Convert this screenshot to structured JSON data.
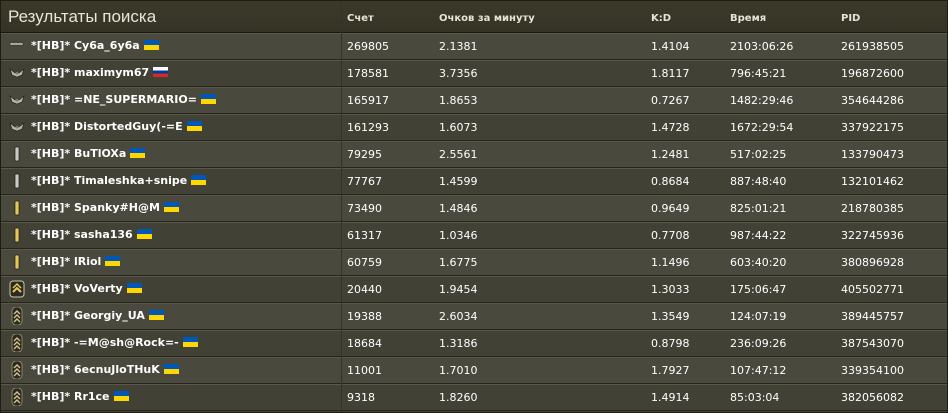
{
  "header": {
    "title": "Результаты поиска",
    "col_score": "Счет",
    "col_ppm": "Очков за минуту",
    "col_kd": "K:D",
    "col_time": "Время",
    "col_pid": "PID"
  },
  "rows": [
    {
      "rank_icon": "rank-stars-icon",
      "name": "*[HB]* Cy6a_6y6a",
      "flag": "ua",
      "score": "269805",
      "ppm": "2.1381",
      "kd": "1.4104",
      "time": "2103:06:26",
      "pid": "261938505"
    },
    {
      "rank_icon": "rank-eagle-icon",
      "name": "*[HB]* maximym67",
      "flag": "ru",
      "score": "178581",
      "ppm": "3.7356",
      "kd": "1.8117",
      "time": "796:45:21",
      "pid": "196872600"
    },
    {
      "rank_icon": "rank-eagle-icon",
      "name": "*[HB]* =NE_SUPERMARIO=",
      "flag": "ua",
      "score": "165917",
      "ppm": "1.8653",
      "kd": "0.7267",
      "time": "1482:29:46",
      "pid": "354644286"
    },
    {
      "rank_icon": "rank-eagle-icon",
      "name": "*[HB]* DistortedGuy(-=E",
      "flag": "ua",
      "score": "161293",
      "ppm": "1.6073",
      "kd": "1.4728",
      "time": "1672:29:54",
      "pid": "337922175"
    },
    {
      "rank_icon": "rank-silver-bar-icon",
      "name": "*[HB]* BuTlOXa",
      "flag": "ua",
      "score": "79295",
      "ppm": "2.5561",
      "kd": "1.2481",
      "time": "517:02:25",
      "pid": "133790473"
    },
    {
      "rank_icon": "rank-silver-bar-icon",
      "name": "*[HB]* Timaleshka+snipe",
      "flag": "ua",
      "score": "77767",
      "ppm": "1.4599",
      "kd": "0.8684",
      "time": "887:48:40",
      "pid": "132101462"
    },
    {
      "rank_icon": "rank-gold-bar-icon",
      "name": "*[HB]* Spanky#H@M",
      "flag": "ua",
      "score": "73490",
      "ppm": "1.4846",
      "kd": "0.9649",
      "time": "825:01:21",
      "pid": "218780385"
    },
    {
      "rank_icon": "rank-gold-bar-icon",
      "name": "*[HB]* sasha136",
      "flag": "ua",
      "score": "61317",
      "ppm": "1.0346",
      "kd": "0.7708",
      "time": "987:44:22",
      "pid": "322745936"
    },
    {
      "rank_icon": "rank-gold-bar-icon",
      "name": "*[HB]* lRiol",
      "flag": "ua",
      "score": "60759",
      "ppm": "1.6775",
      "kd": "1.1496",
      "time": "603:40:20",
      "pid": "380896928"
    },
    {
      "rank_icon": "rank-chevron-star-icon",
      "name": "*[HB]* VoVerty",
      "flag": "ua",
      "score": "20440",
      "ppm": "1.9454",
      "kd": "1.3033",
      "time": "175:06:47",
      "pid": "405502771"
    },
    {
      "rank_icon": "rank-chevron-icon",
      "name": "*[HB]* Georgiy_UA",
      "flag": "ua",
      "score": "19388",
      "ppm": "2.6034",
      "kd": "1.3549",
      "time": "124:07:19",
      "pid": "389445757"
    },
    {
      "rank_icon": "rank-chevron-icon",
      "name": "*[HB]* -=M@sh@Rock=-",
      "flag": "ua",
      "score": "18684",
      "ppm": "1.3186",
      "kd": "0.8798",
      "time": "236:09:26",
      "pid": "387543070"
    },
    {
      "rank_icon": "rank-chevron-icon",
      "name": "*[HB]* 6ecnuJloTHuK",
      "flag": "ua",
      "score": "11001",
      "ppm": "1.7010",
      "kd": "1.7927",
      "time": "107:47:12",
      "pid": "339354100"
    },
    {
      "rank_icon": "rank-chevron-icon",
      "name": "*[HB]* Rr1ce",
      "flag": "ua",
      "score": "9318",
      "ppm": "1.8260",
      "kd": "1.4914",
      "time": "85:03:04",
      "pid": "382056082"
    }
  ]
}
